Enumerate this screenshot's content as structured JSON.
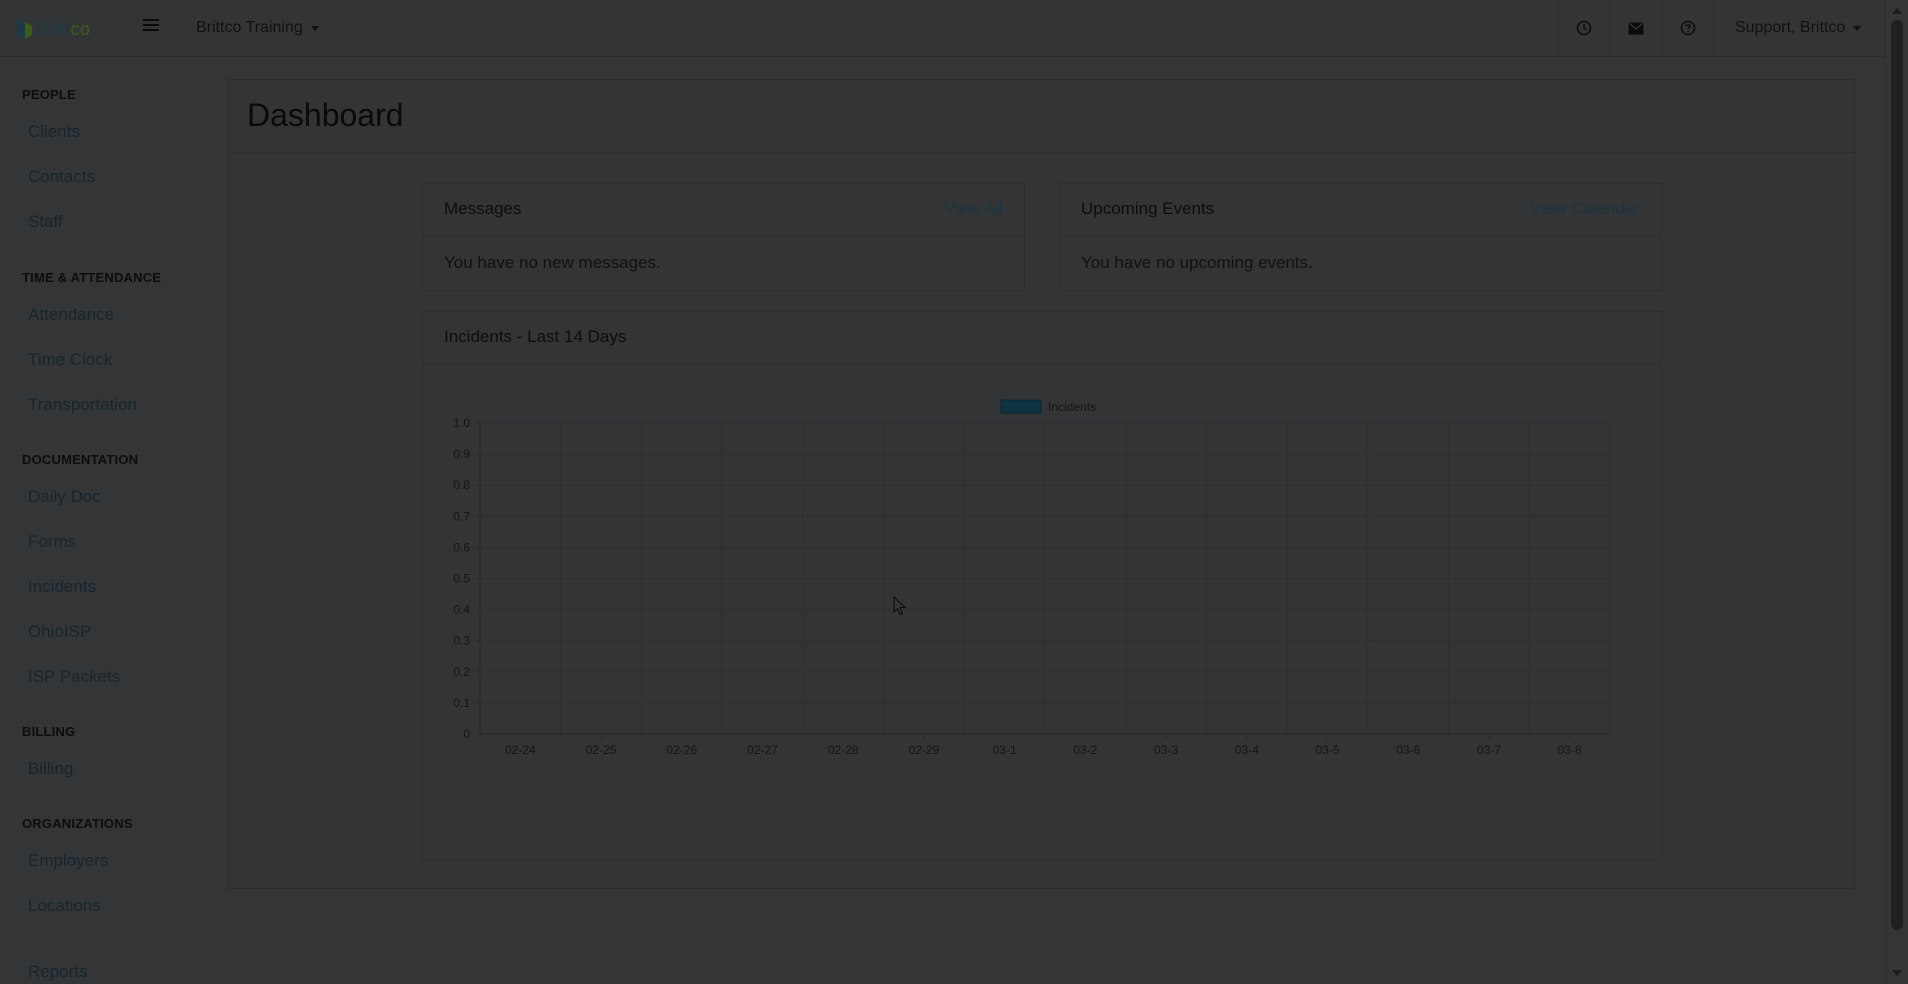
{
  "header": {
    "logo_text_a": "Britt",
    "logo_text_b": "co",
    "org_name": "Brittco Training",
    "user_name": "Support, Brittco",
    "icons": [
      "clock-icon",
      "envelope-icon",
      "help-circle-icon"
    ]
  },
  "sidebar": {
    "people": {
      "heading": "PEOPLE",
      "items": [
        "Clients",
        "Contacts",
        "Staff"
      ]
    },
    "time": {
      "heading": "TIME & ATTENDANCE",
      "items": [
        "Attendance",
        "Time Clock",
        "Transportation"
      ]
    },
    "docs": {
      "heading": "DOCUMENTATION",
      "items": [
        "Daily Doc",
        "Forms",
        "Incidents",
        "OhioISP",
        "ISP Packets"
      ]
    },
    "billing": {
      "heading": "BILLING",
      "items": [
        "Billing"
      ]
    },
    "orgs": {
      "heading": "ORGANIZATIONS",
      "items": [
        "Employers",
        "Locations"
      ]
    },
    "reports": "Reports"
  },
  "main": {
    "title": "Dashboard",
    "messages": {
      "title": "Messages",
      "link": "View All",
      "body": "You have no new messages."
    },
    "events": {
      "title": "Upcoming Events",
      "link": "View Calendar",
      "body": "You have no upcoming events."
    },
    "incidents": {
      "title": "Incidents - Last 14 Days"
    }
  },
  "colors": {
    "series": "#0e3444",
    "link": "#1b3440"
  },
  "chart_data": {
    "type": "bar",
    "title": "",
    "xlabel": "",
    "ylabel": "",
    "categories": [
      "02-24",
      "02-25",
      "02-26",
      "02-27",
      "02-28",
      "02-29",
      "03-1",
      "03-2",
      "03-3",
      "03-4",
      "03-5",
      "03-6",
      "03-7",
      "03-8"
    ],
    "series": [
      {
        "name": "Incidents",
        "values": [
          0,
          0,
          0,
          0,
          0,
          0,
          0,
          0,
          0,
          0,
          0,
          0,
          0,
          0
        ]
      }
    ],
    "yticks": [
      "0",
      "0.1",
      "0.2",
      "0.3",
      "0.4",
      "0.5",
      "0.6",
      "0.7",
      "0.8",
      "0.9",
      "1.0"
    ],
    "ylim": [
      0,
      1
    ],
    "grid": true,
    "legend": "top-center"
  }
}
